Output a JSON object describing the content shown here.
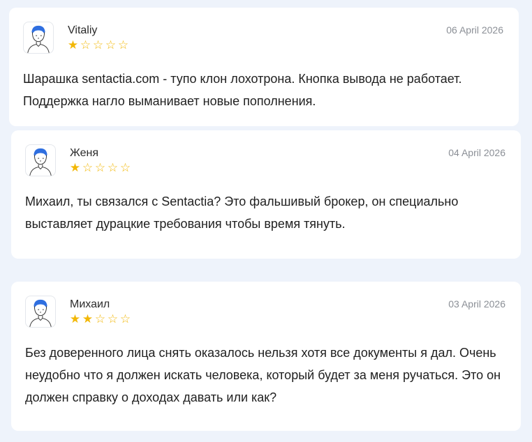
{
  "reviews": [
    {
      "name": "Vitaliy",
      "date": "06 April 2026",
      "rating": 1,
      "text": "Шарашка sentactia.com - тупо клон лохотрона. Кнопка вывода не работает. Поддержка нагло выманивает новые пополнения.",
      "avatar_icon": "user-avatar-icon"
    },
    {
      "name": "Женя",
      "date": "04 April 2026",
      "rating": 1,
      "text": "Михаил, ты связался с Sentactia? Это фальшивый брокер, он специально выставляет дурацкие требования чтобы время тянуть.",
      "avatar_icon": "user-avatar-icon"
    },
    {
      "name": "Михаил",
      "date": "03 April 2026",
      "rating": 2,
      "text": "Без доверенного лица снять оказалось нельзя хотя все документы я дал. Очень неудобно что я должен искать человека, который будет за меня ручаться. Это он должен справку о доходах давать или как?",
      "avatar_icon": "user-avatar-icon"
    }
  ],
  "max_rating": 5,
  "colors": {
    "background": "#eef3fb",
    "card": "#ffffff",
    "star": "#f2b705",
    "date": "#8b8f96",
    "avatar_hair": "#2f6fe0"
  }
}
